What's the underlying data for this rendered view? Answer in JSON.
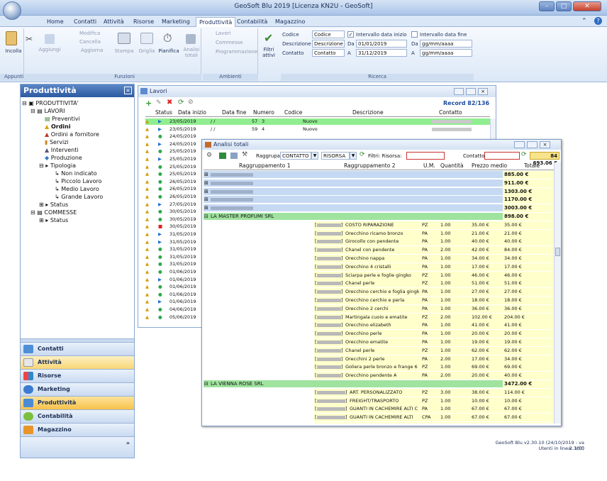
{
  "window": {
    "title": "GeoSoft Blu 2019 [Licenza KN2U - GeoSoft]"
  },
  "ribbon_tabs": [
    "Home",
    "Contatti",
    "Attività",
    "Risorse",
    "Marketing",
    "Produttività",
    "Contabilità",
    "Magazzino"
  ],
  "ribbon": {
    "appunti": {
      "label": "Appunti",
      "incolla": "Incolla",
      "aggiungi": "Aggiungi",
      "modifica": "Modifica",
      "cancella": "Cancella",
      "aggiorna": "Aggiorna"
    },
    "funzioni": {
      "label": "Funzioni",
      "stampa": "Stampa",
      "griglia": "Griglia",
      "pianifica": "Pianifica",
      "analisi": "Analisi totali"
    },
    "ambienti": {
      "label": "Ambienti",
      "lavori": "Lavori",
      "commesse": "Commesse",
      "programmazione": "Programmazione"
    },
    "filtri": {
      "label": "Filtri attivi"
    },
    "ricerca": {
      "label": "Ricerca",
      "codice_label": "Codice",
      "codice_ph": "Codice",
      "descrizione_label": "Descrizione",
      "descrizione_ph": "Descrizione",
      "contatto_label": "Contatto",
      "contatto_ph": "Contatto",
      "intervallo_inizio": "Intervallo data inizio",
      "da": "Da",
      "a": "A",
      "inizio_da": "01/01/2019",
      "inizio_a": "31/12/2019",
      "intervallo_fine": "Intervallo data fine",
      "fine_da": "gg/mm/aaaa",
      "fine_a": "gg/mm/aaaa"
    }
  },
  "nav": {
    "title": "Produttività",
    "tree": [
      "PRODUTTIVITA'",
      "LAVORI",
      "Preventivi",
      "Ordini",
      "Ordini a fornitore",
      "Servizi",
      "Interventi",
      "Produzione",
      "Tipologia",
      "Non indicato",
      "Piccolo Lavoro",
      "Medio Lavoro",
      "Grande Lavoro",
      "Status",
      "COMMESSE",
      "Status"
    ],
    "buttons": [
      "Contatti",
      "Attività",
      "Risorse",
      "Marketing",
      "Produttività",
      "Contabilità",
      "Magazzino"
    ]
  },
  "lavori": {
    "title": "Lavori",
    "record": "Record 82/136",
    "cols": [
      "Status",
      "Data inizio",
      "Data fine",
      "Numero",
      "Codice",
      "Descrizione",
      "Contatto"
    ],
    "dates": [
      "23/05/2019",
      "23/05/2019",
      "24/05/2019",
      "24/05/2019",
      "25/05/2019",
      "25/05/2019",
      "25/05/2019",
      "25/05/2019",
      "26/05/2019",
      "26/05/2019",
      "26/05/2019",
      "27/05/2019",
      "30/05/2019",
      "30/05/2019",
      "30/05/2019",
      "31/05/2019",
      "31/05/2019",
      "31/05/2019",
      "31/05/2019",
      "31/05/2019",
      "01/06/2019",
      "01/06/2019",
      "01/06/2019",
      "01/06/2019",
      "01/06/2019",
      "04/06/2019",
      "05/06/2019"
    ],
    "row0": {
      "fine": "/ /",
      "numero": "57",
      "codice": "3",
      "descrizione": "Nuovo"
    },
    "row1": {
      "fine": "/ /",
      "numero": "59",
      "codice": "4",
      "descrizione": "Nuovo"
    }
  },
  "analisi": {
    "title": "Analisi totali",
    "raggrupa_label": "Raggrupa:",
    "raggr1": "CONTATTO",
    "raggr2": "RISORSA",
    "filtri_label": "Filtri: Risorsa:",
    "contatto_label": "Contatto:",
    "total": "84 693.06 €",
    "cols": [
      "Raggruppamento 1",
      "Raggruppamento 2",
      "U.M.",
      "Quantità",
      "Prezzo medio",
      "Totale"
    ],
    "groups_top_totals": [
      "885.00 €",
      "911.00 €",
      "1303.00 €",
      "1170.00 €",
      "3003.00 €"
    ],
    "group_master": {
      "name": "LA MASTER PROFUMI SRL",
      "total": "898.00 €"
    },
    "master_rows": [
      [
        "COSTO RIPARAZIONE",
        "PZ",
        "1.00",
        "35.00 €",
        "35.00 €"
      ],
      [
        "Orecchino ricamo bronzo",
        "PA",
        "1.00",
        "21.00 €",
        "21.00 €"
      ],
      [
        "Girocollo con pendente",
        "PA",
        "1.00",
        "40.00 €",
        "40.00 €"
      ],
      [
        "Chanel con pendente",
        "PA",
        "2.00",
        "42.00 €",
        "84.00 €"
      ],
      [
        "Orecchino nappa",
        "PA",
        "1.00",
        "34.00 €",
        "34.00 €"
      ],
      [
        "Orecchino 4 cristalli",
        "PA",
        "1.00",
        "17.00 €",
        "17.00 €"
      ],
      [
        "Sciarpa perle e foglie gingko",
        "PZ",
        "1.00",
        "46.00 €",
        "46.00 €"
      ],
      [
        "Chanel perle",
        "PZ",
        "1.00",
        "51.00 €",
        "51.00 €"
      ],
      [
        "Orecchino cerchio e foglia gingko",
        "PA",
        "1.00",
        "27.00 €",
        "27.00 €"
      ],
      [
        "Orecchino cerchio e perla",
        "PA",
        "1.00",
        "18.00 €",
        "18.00 €"
      ],
      [
        "Orecchino 2 cerchi",
        "PA",
        "1.00",
        "36.00 €",
        "36.00 €"
      ],
      [
        "Martingala cuoio e ematite",
        "PZ",
        "2.00",
        "102.00 €",
        "204.00 €"
      ],
      [
        "Orecchino elizabeth",
        "PA",
        "1.00",
        "41.00 €",
        "41.00 €"
      ],
      [
        "Orecchino perle",
        "PA",
        "1.00",
        "20.00 €",
        "20.00 €"
      ],
      [
        "Orecchino ematite",
        "PA",
        "1.00",
        "19.00 €",
        "19.00 €"
      ],
      [
        "Chanel perle",
        "PZ",
        "1.00",
        "62.00 €",
        "62.00 €"
      ],
      [
        "Orecchini 2 perle",
        "PA",
        "2.00",
        "17.00 €",
        "34.00 €"
      ],
      [
        "Goliera perle bronzo e frange 6 fil",
        "PZ",
        "1.00",
        "69.00 €",
        "69.00 €"
      ],
      [
        "Orecchino pendente A",
        "PA",
        "2.00",
        "20.00 €",
        "40.00 €"
      ]
    ],
    "group_vienna": {
      "name": "LA VIENNA ROSE SRL",
      "total": "3472.00 €"
    },
    "vienna_rows": [
      [
        "ART. PERSONALIZZATO",
        "PZ",
        "3.00",
        "38.00 €",
        "114.00 €"
      ],
      [
        "FREIGHT/TRASPORTO",
        "PZ",
        "1.00",
        "10.00 €",
        "10.00 €"
      ],
      [
        "GUANTI IN CACHEMIRE ALTI C",
        "PA",
        "1.00",
        "67.00 €",
        "67.00 €"
      ],
      [
        "GUANTI IN CACHEMIRE ALTI",
        "CPA",
        "1.00",
        "67.00 €",
        "67.00 €"
      ],
      [
        "GUANTI IN CACHEMIRE ALTI C.",
        "PA",
        "3.00",
        "67.00 €",
        "201.00 €"
      ]
    ]
  },
  "statusbar": {
    "version": "GeoSoft Blu  v2.30.10 (24/10/2019 - va 2.303)",
    "users": "Utenti in linea: 1/10"
  },
  "colors": {
    "ribbon_blue": "#dce8f7",
    "nav_header": "#2c5aa0",
    "selected_row": "#90ee90",
    "group_green": "#9fe39f",
    "total_yellow": "#ffffcc",
    "group_blue": "#c6d9f3"
  }
}
